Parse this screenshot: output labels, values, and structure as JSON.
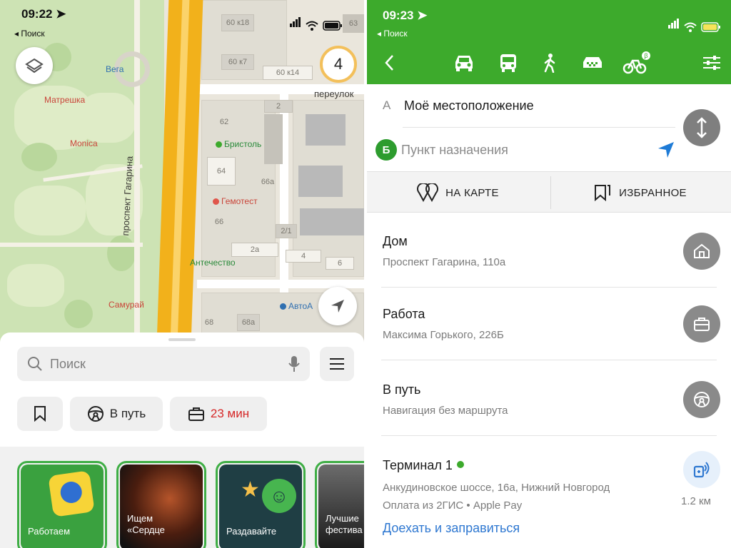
{
  "left_screen": {
    "status": {
      "time": "09:22",
      "back_label": "◂ Поиск"
    },
    "map": {
      "places": {
        "vega": "Вега",
        "matreshka": "Матрешка",
        "monica": "Monica",
        "bristol": "Бристоль",
        "gemotest": "Гемотест",
        "aptechestvo": "Антечество",
        "samurai": "Самурай",
        "avto": "АвтоА"
      },
      "street_labels": {
        "avenue": "проспект Гагарина",
        "pereulok": "переулок"
      },
      "building_numbers": [
        "60 к18",
        "60 к7",
        "60 к14",
        "2",
        "62",
        "64",
        "66а",
        "66",
        "2/1",
        "2а",
        "4",
        "6",
        "68",
        "68а",
        "63"
      ],
      "zoom_badge": "4"
    },
    "sheet": {
      "search_placeholder": "Поиск",
      "chips": {
        "route": "В путь",
        "work_time": "23 мин"
      },
      "stories": [
        "Работаем",
        "Ищем\n«Сердце",
        "Раздавайте",
        "Лучшие\nфестива"
      ]
    }
  },
  "right_screen": {
    "status": {
      "time": "09:23",
      "back_label": "◂ Поиск"
    },
    "accent_color": "#3daa2c",
    "from": {
      "letter": "А",
      "value": "Моё местоположение"
    },
    "to": {
      "letter": "Б",
      "placeholder": "Пункт назначения"
    },
    "tabs": {
      "on_map": "НА КАРТЕ",
      "favorites": "ИЗБРАННОЕ"
    },
    "places": [
      {
        "title": "Дом",
        "subtitle": "Проспект Гагарина, 110а",
        "icon": "home-icon"
      },
      {
        "title": "Работа",
        "subtitle": "Максима Горького, 226Б",
        "icon": "briefcase-icon"
      },
      {
        "title": "В путь",
        "subtitle": "Навигация без маршрута",
        "icon": "steering-wheel-icon"
      }
    ],
    "station": {
      "title": "Терминал 1",
      "address": "Анкудиновское шоссе, 16а, Нижний Новгород",
      "payment": "Оплата из 2ГИС • Apple Pay",
      "distance": "1.2 км",
      "action": "Доехать и заправиться"
    }
  }
}
